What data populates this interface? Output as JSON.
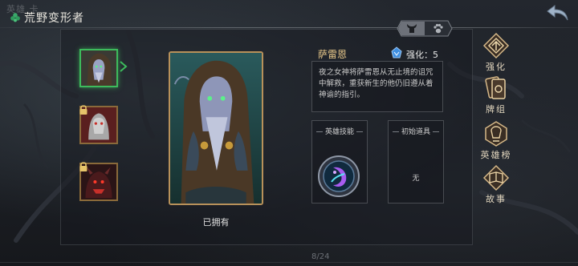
{
  "header": {
    "title": "荒野变形者",
    "ghost_tabs": "英雄  卡"
  },
  "switch_tabs": [
    {
      "icon": "horned-helmet-icon",
      "active": true
    },
    {
      "icon": "paw-icon",
      "active": false
    }
  ],
  "heroes": [
    {
      "name": "hooded-shaman",
      "selected": true,
      "locked": false
    },
    {
      "name": "white-beast",
      "selected": false,
      "locked": true
    },
    {
      "name": "red-demon",
      "selected": false,
      "locked": true
    }
  ],
  "portrait": {
    "status": "已拥有"
  },
  "hero": {
    "name": "萨雷恩",
    "enhance_label": "强化：",
    "enhance_value": "5",
    "description": "夜之女神将萨雷恩从无止境的诅咒中解救，重获新生的他仍旧遵从着神谕的指引。"
  },
  "hero_skill": {
    "title": "英雄技能",
    "icon": "moon-spirit-skill-icon"
  },
  "initial_item": {
    "title": "初始道具",
    "value": "无"
  },
  "menu": [
    {
      "label": "强化",
      "icon": "upgrade-icon"
    },
    {
      "label": "牌组",
      "icon": "card-deck-icon"
    },
    {
      "label": "英雄榜",
      "icon": "leaderboard-icon"
    },
    {
      "label": "故事",
      "icon": "story-book-icon"
    }
  ],
  "footer": {
    "page_count": "8/24"
  },
  "colors": {
    "accent_gold": "#b8915a",
    "selected_green": "#3dbb5c",
    "name_gold": "#e8c88a",
    "enhance_blue": "#3f8fe0"
  }
}
